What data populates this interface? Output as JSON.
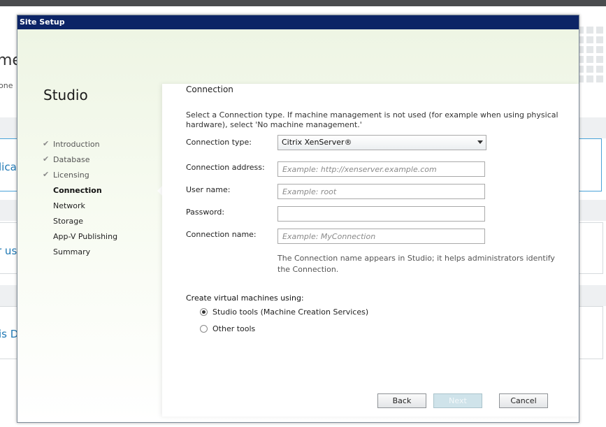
{
  "background": {
    "title_fragment": "me",
    "subtitle_fragment": "one",
    "card1_text": "lica",
    "card2_text": "r us",
    "card3_text": "is D"
  },
  "dialog": {
    "title": "Site Setup",
    "nav_title": "Studio",
    "nav_items": [
      {
        "label": "Introduction",
        "state": "done"
      },
      {
        "label": "Database",
        "state": "done"
      },
      {
        "label": "Licensing",
        "state": "done"
      },
      {
        "label": "Connection",
        "state": "current"
      },
      {
        "label": "Network",
        "state": "pending"
      },
      {
        "label": "Storage",
        "state": "pending"
      },
      {
        "label": "App-V Publishing",
        "state": "pending"
      },
      {
        "label": "Summary",
        "state": "pending"
      }
    ],
    "check_glyph": "✔",
    "section_title": "Connection",
    "intro": "Select a Connection type. If machine management is not used (for example when using physical hardware), select 'No machine management.'",
    "connection_type": {
      "label": "Connection type:",
      "value": "Citrix XenServer®"
    },
    "connection_address": {
      "label": "Connection address:",
      "value": "",
      "placeholder": "Example: http://xenserver.example.com"
    },
    "user_name": {
      "label": "User name:",
      "value": "",
      "placeholder": "Example: root"
    },
    "password": {
      "label": "Password:",
      "value": ""
    },
    "connection_name": {
      "label": "Connection name:",
      "value": "",
      "placeholder": "Example: MyConnection"
    },
    "name_hint": "The Connection name appears in Studio; it helps administrators identify the Connection.",
    "create_label": "Create virtual machines using:",
    "radio_options": [
      {
        "label": "Studio tools (Machine Creation Services)",
        "checked": true
      },
      {
        "label": "Other tools",
        "checked": false
      }
    ],
    "buttons": {
      "back": "Back",
      "next": "Next",
      "cancel": "Cancel"
    }
  },
  "colors": {
    "titlebar": "#0c2466",
    "accent_blue": "#1e78b4",
    "next_disabled": "#cfe3ea"
  }
}
